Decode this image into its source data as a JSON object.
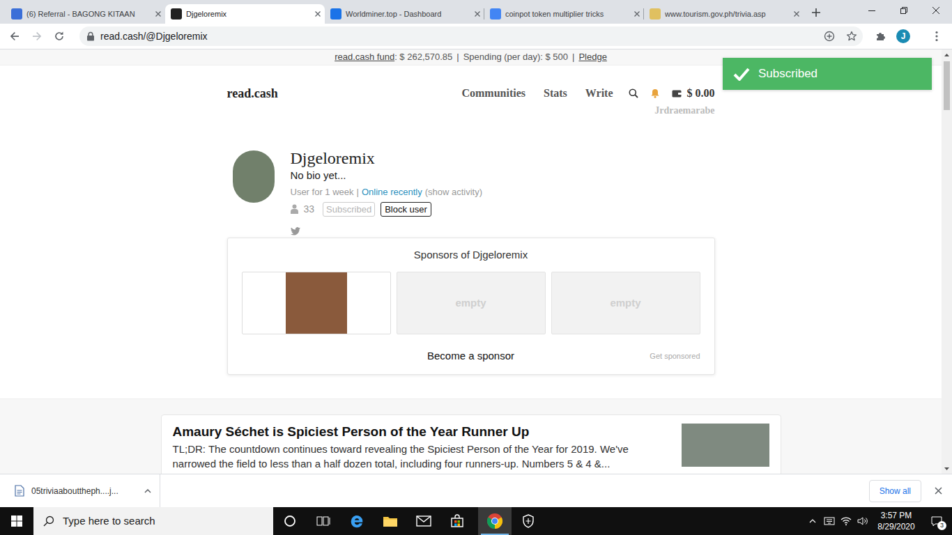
{
  "browser": {
    "tabs": [
      {
        "label": "(6) Referral - BAGONG KITAAN",
        "selected": false
      },
      {
        "label": "Djgeloremix",
        "selected": true
      },
      {
        "label": "Worldminer.top - Dashboard",
        "selected": false
      },
      {
        "label": "coinpot token multiplier tricks",
        "selected": false
      },
      {
        "label": "www.tourism.gov.ph/trivia.asp",
        "selected": false
      }
    ],
    "address": {
      "url": "read.cash/@Djgeloremix"
    },
    "profile_initial": "J"
  },
  "page": {
    "fund_bar": {
      "fund_label": "read.cash fund",
      "fund_value": ": $ 262,570.85",
      "separator": "|",
      "spending": "Spending (per day): $ 500",
      "pledge": "Pledge"
    },
    "nav": {
      "logo": "read.cash",
      "links": [
        {
          "label": "Communities"
        },
        {
          "label": "Stats"
        },
        {
          "label": "Write"
        }
      ],
      "balance": "$ 0.00",
      "username": "Jrdraemarabe"
    },
    "toast": {
      "text": "Subscribed"
    },
    "profile": {
      "name": "Djgeloremix",
      "bio": "No bio yet...",
      "user_for": "User for 1 week",
      "separator": "|",
      "online": "Online recently",
      "activity": "(show activity)",
      "subscribers": "33",
      "subscribe_button": "Subscribed",
      "subscribed": true,
      "block_button": "Block user"
    },
    "sponsors": {
      "title": "Sponsors of Djgeloremix",
      "slots": [
        {
          "filled": true
        },
        {
          "filled": false,
          "label": "empty"
        },
        {
          "filled": false,
          "label": "empty"
        }
      ],
      "become": "Become a sponsor",
      "get": "Get sponsored"
    },
    "articles": [
      {
        "title": "Amaury Séchet is Spiciest Person of the Year Runner Up",
        "excerpt": "TL;DR: The countdown continues toward revealing the Spiciest Person of the Year for 2019. We've narrowed the field to less than a half dozen total, including four runners-up. Numbers 5 & 4 &..."
      }
    ]
  },
  "download_bar": {
    "file": "05triviaabouttheph....j...",
    "show_all": "Show all"
  },
  "taskbar": {
    "search_placeholder": "Type here to search",
    "apps": [
      {
        "kind": "cortana",
        "active": false
      },
      {
        "kind": "taskview",
        "active": false
      },
      {
        "kind": "edge",
        "active": false
      },
      {
        "kind": "explorer",
        "active": false
      },
      {
        "kind": "mail",
        "active": false
      },
      {
        "kind": "store",
        "active": false
      },
      {
        "kind": "chrome",
        "active": true
      },
      {
        "kind": "security",
        "active": false
      }
    ],
    "time": "3:57 PM",
    "date": "8/29/2020",
    "notifications": "3"
  }
}
